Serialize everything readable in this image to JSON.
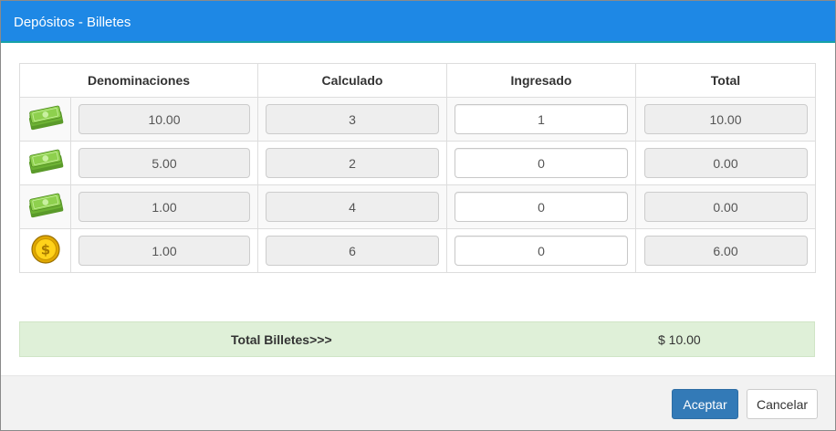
{
  "dialog": {
    "title": "Depósitos - Billetes"
  },
  "table": {
    "headers": {
      "denominaciones": "Denominaciones",
      "calculado": "Calculado",
      "ingresado": "Ingresado",
      "total": "Total"
    },
    "rows": [
      {
        "icon": "banknotes-icon",
        "denominacion": "10.00",
        "calculado": "3",
        "ingresado": "1",
        "total": "10.00"
      },
      {
        "icon": "banknotes-icon",
        "denominacion": "5.00",
        "calculado": "2",
        "ingresado": "0",
        "total": "0.00"
      },
      {
        "icon": "banknotes-icon",
        "denominacion": "1.00",
        "calculado": "4",
        "ingresado": "0",
        "total": "0.00"
      },
      {
        "icon": "coin-icon",
        "denominacion": "1.00",
        "calculado": "6",
        "ingresado": "0",
        "total": "6.00"
      }
    ]
  },
  "summary": {
    "label": "Total Billetes>>>",
    "value": "$ 10.00"
  },
  "footer": {
    "accept_label": "Aceptar",
    "cancel_label": "Cancelar"
  },
  "colors": {
    "header": "#1e88e5",
    "summary_bg": "#dff0d8",
    "primary_button": "#337ab7",
    "bill_green": "#7cc242",
    "coin_gold": "#f5c400"
  }
}
